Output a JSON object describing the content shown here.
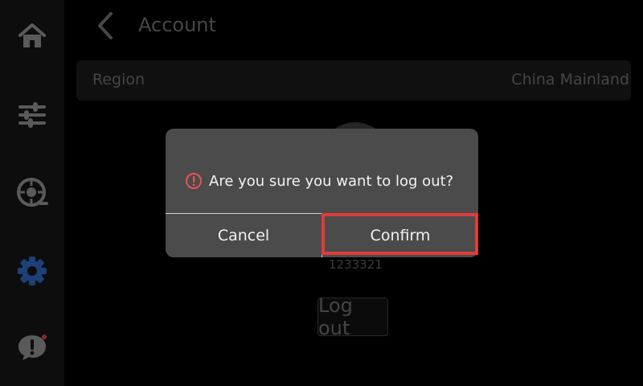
{
  "header": {
    "title": "Account"
  },
  "region": {
    "label": "Region",
    "value": "China Mainland"
  },
  "account": {
    "id": "1233321"
  },
  "actions": {
    "logout_label": "Log out"
  },
  "dialog": {
    "message": "Are you sure you want to log out?",
    "cancel_label": "Cancel",
    "confirm_label": "Confirm"
  },
  "sidebar": {
    "items": [
      {
        "icon": "home-icon"
      },
      {
        "icon": "sliders-icon"
      },
      {
        "icon": "filament-spool-icon"
      },
      {
        "icon": "gear-icon",
        "active": true
      },
      {
        "icon": "alert-message-icon",
        "notification_dot": true
      }
    ]
  },
  "colors": {
    "accent": "#2f63b8",
    "highlight": "#e03a3a",
    "warning": "#e85555"
  }
}
